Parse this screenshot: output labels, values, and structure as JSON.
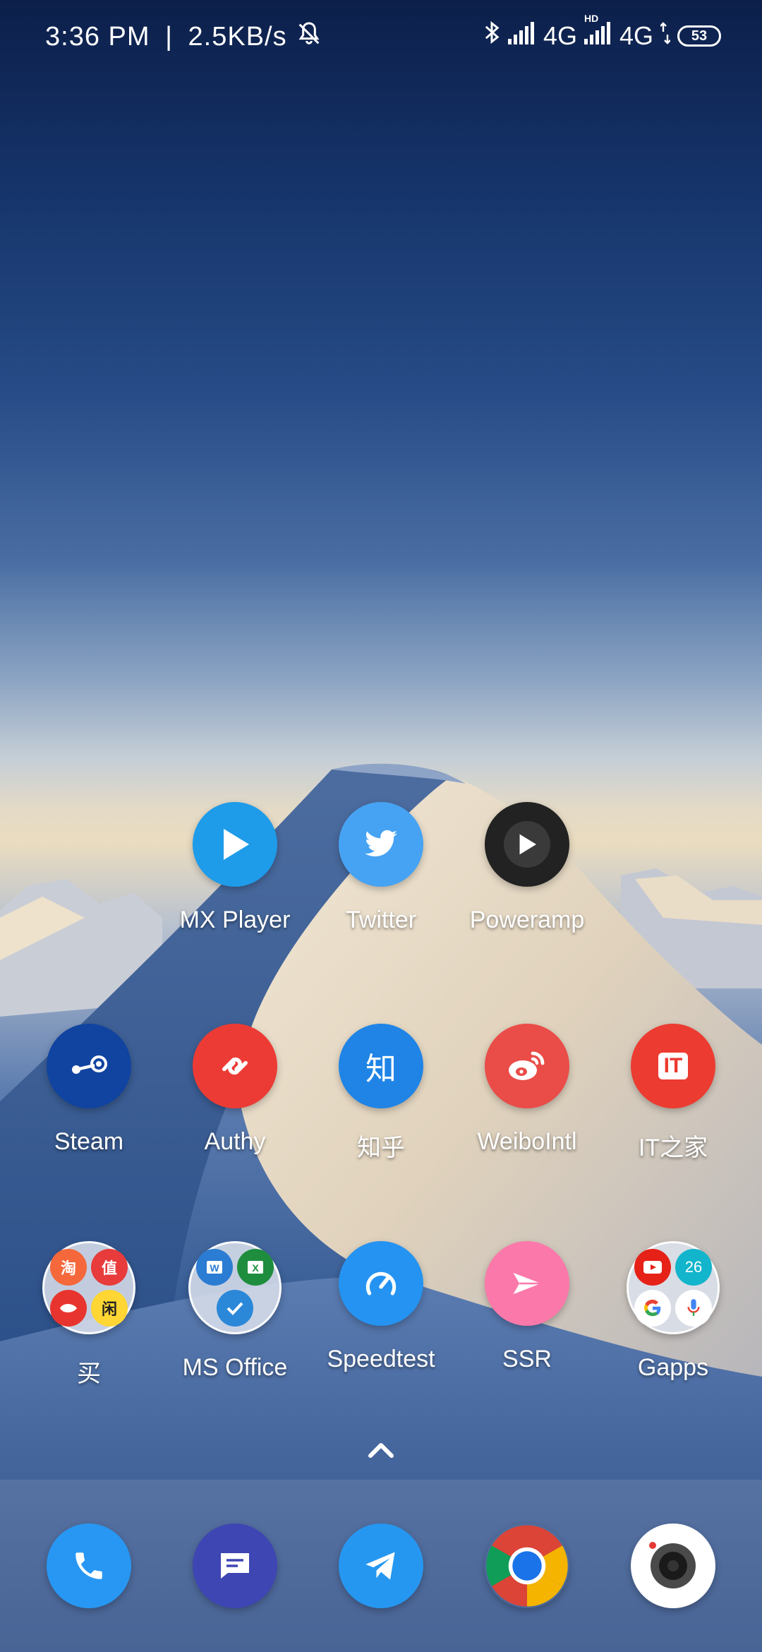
{
  "status_bar": {
    "time": "3:36  PM",
    "separator": "|",
    "net_speed": "2.5KB/s",
    "net1": "4G",
    "hd_badge": "HD",
    "net2": "4G",
    "battery": "53"
  },
  "apps": {
    "row1": [
      {
        "label": "MX Player",
        "icon": "play-icon",
        "color": "#1e9be9"
      },
      {
        "label": "Twitter",
        "icon": "twitter-bird-icon",
        "color": "#46a3f3"
      },
      {
        "label": "Poweramp",
        "icon": "play-icon",
        "color": "#222222"
      }
    ],
    "row2": [
      {
        "label": "Steam",
        "icon": "steam-icon",
        "color": "#1144a0"
      },
      {
        "label": "Authy",
        "icon": "authy-icon",
        "color": "#ec3b35"
      },
      {
        "label": "知乎",
        "glyph": "知",
        "color": "#1f84e6"
      },
      {
        "label": "WeiboIntl",
        "icon": "weibo-icon",
        "color": "#ea4c48"
      },
      {
        "label": "IT之家",
        "glyph": "IT",
        "color": "#ec3b30"
      }
    ],
    "row3": [
      {
        "label": "买",
        "type": "folder",
        "minis": [
          "淘",
          "值",
          "",
          "闲"
        ]
      },
      {
        "label": "MS Office",
        "type": "folder"
      },
      {
        "label": "Speedtest",
        "icon": "speedometer-icon",
        "color": "#2593f1"
      },
      {
        "label": "SSR",
        "icon": "paper-plane-icon",
        "color": "#fb79aa"
      },
      {
        "label": "Gapps",
        "type": "folder",
        "minis": [
          "",
          "26",
          "",
          ""
        ]
      }
    ]
  },
  "dock": [
    {
      "name": "phone",
      "icon": "phone-icon",
      "color": "#2897f3"
    },
    {
      "name": "messages",
      "icon": "message-icon",
      "color": "#3e46b3"
    },
    {
      "name": "telegram",
      "icon": "telegram-icon",
      "color": "#2697f0"
    },
    {
      "name": "chrome",
      "icon": "chrome-icon"
    },
    {
      "name": "camera",
      "icon": "camera-icon",
      "color": "#ffffff"
    }
  ]
}
